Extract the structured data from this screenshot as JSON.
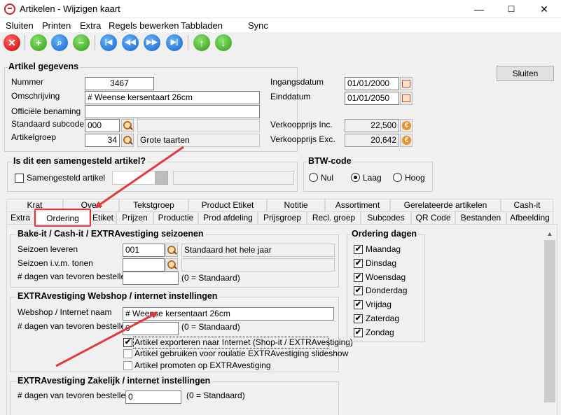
{
  "window": {
    "title": "Artikelen - Wijzigen kaart",
    "minimize": "—",
    "maximize": "☐",
    "close": "✕"
  },
  "menu": [
    "Sluiten",
    "Printen",
    "Extra",
    "Regels bewerken",
    "Tabbladen",
    "Sync"
  ],
  "toolbar_icons": [
    "close-icon",
    "add-icon",
    "search-icon",
    "remove-icon",
    "first-icon",
    "previous-icon",
    "next-icon",
    "last-icon",
    "up-icon",
    "down-icon"
  ],
  "artikel": {
    "legend": "Artikel gegevens",
    "nummer_label": "Nummer",
    "nummer": "3467",
    "omschrijving_label": "Omschrijving",
    "omschrijving": "# Weense kersentaart 26cm",
    "officiele_label": "Officiële benaming",
    "officiele": "",
    "subcode_label": "Standaard subcode",
    "subcode": "000",
    "subcode_desc": "",
    "groep_label": "Artikelgroep",
    "groep": "34",
    "groep_desc": "Grote taarten",
    "ingang_label": "Ingangsdatum",
    "ingang": "01/01/2000",
    "eind_label": "Einddatum",
    "eind": "01/01/2050",
    "vk_inc_label": "Verkoopprijs Inc.",
    "vk_inc": "22,500",
    "vk_exc_label": "Verkoopprijs Exc.",
    "vk_exc": "20,642",
    "sluiten_button": "Sluiten"
  },
  "samengesteld": {
    "legend": "Is dit een samengesteld artikel?",
    "checkbox_label": "Samengesteld artikel",
    "checked": false
  },
  "btw": {
    "legend": "BTW-code",
    "options": [
      "Nul",
      "Laag",
      "Hoog"
    ],
    "selected": "Laag"
  },
  "tabs_row1": [
    "Krat",
    "Oven",
    "Tekstgroep",
    "Product Etiket",
    "Notitie",
    "Assortiment",
    "Gerelateerde artikelen",
    "Cash-it"
  ],
  "tabs_row2": [
    "Extra",
    "Ordering",
    "Etiket",
    "Prijzen",
    "Productie",
    "Prod afdeling",
    "Prijsgroep",
    "Recl. groep",
    "Subcodes",
    "QR Code",
    "Bestanden",
    "Afbeelding"
  ],
  "active_tab": "Ordering",
  "seizoenen": {
    "legend": "Bake-it / Cash-it / EXTRAvestiging seizoenen",
    "leveren_label": "Seizoen leveren",
    "leveren": "001",
    "leveren_desc": "Standaard het hele jaar",
    "tonen_label": "Seizoen i.v.m. tonen",
    "tonen": "",
    "tonen_desc": "",
    "dagen_label": "# dagen van tevoren bestellen",
    "dagen": "",
    "dagen_hint": "(0 = Standaard)"
  },
  "webshop": {
    "legend": "EXTRAvestiging Webshop / internet instellingen",
    "naam_label": "Webshop / Internet naam",
    "naam": "# Weense kersentaart 26cm",
    "dagen_label": "# dagen van tevoren bestellen",
    "dagen": "0",
    "dagen_hint": "(0 = Standaard)",
    "options": [
      {
        "label": "Artikel exporteren naar Internet (Shop-it / EXTRAvestiging)",
        "checked": true
      },
      {
        "label": "Artikel gebruiken voor roulatie EXTRAvestiging slideshow",
        "checked": false
      },
      {
        "label": "Artikel promoten op EXTRAvestiging",
        "checked": false
      }
    ]
  },
  "zakelijk": {
    "legend": "EXTRAvestiging Zakelijk / internet instellingen",
    "dagen_label": "# dagen van tevoren bestellen",
    "dagen": "0",
    "dagen_hint": "(0 = Standaard)"
  },
  "ordering_dagen": {
    "legend": "Ordering dagen",
    "days": [
      {
        "label": "Maandag",
        "checked": true
      },
      {
        "label": "Dinsdag",
        "checked": true
      },
      {
        "label": "Woensdag",
        "checked": true
      },
      {
        "label": "Donderdag",
        "checked": true
      },
      {
        "label": "Vrijdag",
        "checked": true
      },
      {
        "label": "Zaterdag",
        "checked": true
      },
      {
        "label": "Zondag",
        "checked": true
      }
    ]
  },
  "check_mark": "✔",
  "annotation_color": "#e0393e"
}
